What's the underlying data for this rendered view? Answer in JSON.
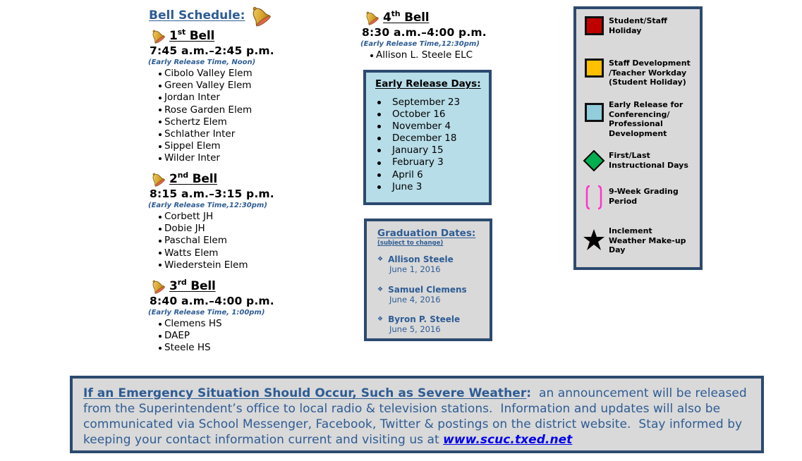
{
  "bell_schedule": {
    "heading": "Bell Schedule:",
    "bells": [
      {
        "number": "1",
        "suffix": "st",
        "word": "Bell",
        "time": "7:45 a.m.–2:45 p.m.",
        "early_release": "(Early Release Time, Noon)",
        "schools": [
          "Cibolo Valley Elem",
          "Green Valley Elem",
          "Jordan Inter",
          "Rose Garden Elem",
          "Schertz Elem",
          "Schlather Inter",
          "Sippel Elem",
          "Wilder Inter"
        ]
      },
      {
        "number": "2",
        "suffix": "nd",
        "word": "Bell",
        "time": "8:15 a.m.–3:15 p.m.",
        "early_release": "(Early Release Time,12:30pm)",
        "schools": [
          "Corbett JH",
          "Dobie JH",
          "Paschal Elem",
          "Watts Elem",
          "Wiederstein Elem"
        ]
      },
      {
        "number": "3",
        "suffix": "rd",
        "word": "Bell",
        "time": "8:40 a.m.–4:00 p.m.",
        "early_release": "(Early Release Time, 1:00pm)",
        "schools": [
          "Clemens HS",
          "DAEP",
          "Steele HS"
        ]
      },
      {
        "number": "4",
        "suffix": "th",
        "word": "Bell",
        "time": "8:30 a.m.–4:00 p.m.",
        "early_release": "(Early Release Time,12:30pm)",
        "schools": [
          "Allison L. Steele ELC"
        ]
      }
    ]
  },
  "early_release_days": {
    "title": "Early Release Days:",
    "dates": [
      "September 23",
      "October 16",
      "November 4",
      "December 18",
      "January 15",
      "February 3",
      "April 6",
      "June 3"
    ]
  },
  "graduation": {
    "title": "Graduation Dates:",
    "subtitle": "(subject to change)",
    "items": [
      {
        "school": "Allison Steele",
        "date": "June 1, 2016"
      },
      {
        "school": "Samuel Clemens",
        "date": "June 4, 2016"
      },
      {
        "school": "Byron P. Steele",
        "date": "June 5, 2016"
      }
    ]
  },
  "legend": {
    "items": [
      {
        "icon": "red-square-icon",
        "color": "#c00000",
        "lines": [
          "Student/Staff",
          "Holiday"
        ]
      },
      {
        "icon": "yellow-square-icon",
        "color": "#ffc000",
        "lines": [
          "Staff Development",
          "/Teacher Workday",
          "(Student Holiday)"
        ]
      },
      {
        "icon": "light-blue-square-icon",
        "color": "#92cddc",
        "lines": [
          "Early Release for",
          "Conferencing/",
          "Professional",
          "Development"
        ]
      },
      {
        "icon": "green-diamond-icon",
        "color": "#00b050",
        "lines": [
          "First/Last",
          "Instructional Days"
        ]
      },
      {
        "icon": "pink-brackets-icon",
        "color": "#ff33cc",
        "lines": [
          "9-Week Grading",
          "Period"
        ]
      },
      {
        "icon": "black-star-icon",
        "color": "#000000",
        "lines": [
          "Inclement",
          "Weather Make-up",
          "Day"
        ]
      }
    ]
  },
  "emergency": {
    "heading": "If an Emergency Situation Should Occur, Such as Severe Weather",
    "colon": ":",
    "body": "  an announcement will be released from the Superintendent’s office to local radio & television stations.  Information and updates will also be communicated via School Messenger, Facebook, Twitter & postings on the district website.  Stay informed by keeping your contact information current and visiting us at ",
    "link": "www.scuc.txed.net"
  },
  "colors": {
    "heading_blue": "#2e5c94",
    "box_border": "#2c4a6e",
    "early_release_bg": "#b7dde8",
    "panel_bg": "#d9d9d9",
    "link": "#0000ee"
  }
}
